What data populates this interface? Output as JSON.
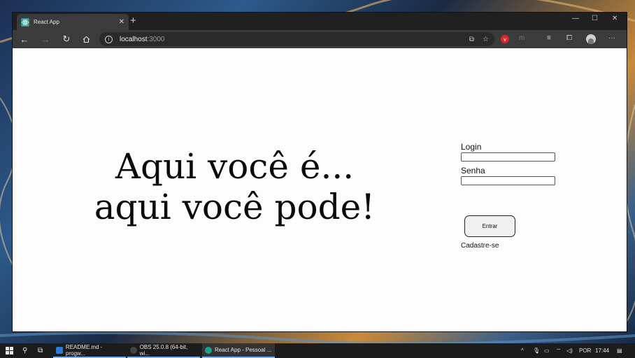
{
  "browser": {
    "tab_title": "React App",
    "new_tab": "+",
    "address_host": "localhost",
    "address_port": ":3000"
  },
  "hero": {
    "line1": "Aqui você é...",
    "line2": "aqui você pode!"
  },
  "login_form": {
    "login_label": "Login",
    "login_value": "",
    "password_label": "Senha",
    "password_value": "",
    "submit_label": "Entrar",
    "signup_link": "Cadastre-se"
  },
  "taskbar": {
    "items": [
      {
        "label": "README.md - progw...",
        "icon": "vscode-icon"
      },
      {
        "label": "OBS 25.0.8 (64-bit, wi...",
        "icon": "obs-icon"
      },
      {
        "label": "React App - Pessoal ...",
        "icon": "edge-icon"
      }
    ],
    "language": "POR",
    "time": "17:44"
  },
  "colors": {
    "page_bg": "#fdfdfd",
    "titlebar": "#202020",
    "toolbar": "#3b3b3b",
    "taskbar": "#1c1c1c"
  }
}
